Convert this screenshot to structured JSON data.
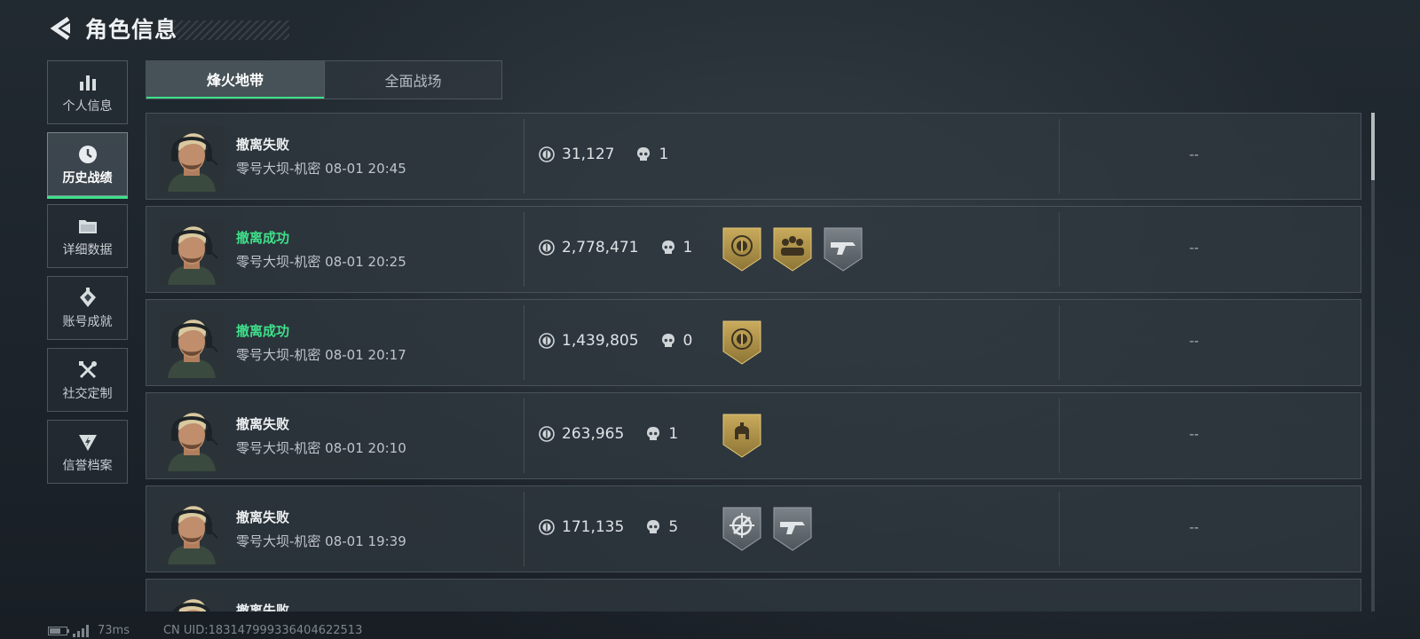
{
  "header": {
    "title": "角色信息",
    "back_icon": "back-arrow-icon"
  },
  "sidebar": {
    "items": [
      {
        "label": "个人信息",
        "icon": "bar-chart-icon",
        "active": false
      },
      {
        "label": "历史战绩",
        "icon": "clock-icon",
        "active": true
      },
      {
        "label": "详细数据",
        "icon": "folder-icon",
        "active": false
      },
      {
        "label": "账号成就",
        "icon": "achievement-icon",
        "active": false
      },
      {
        "label": "社交定制",
        "icon": "tools-icon",
        "active": false
      },
      {
        "label": "信誉档案",
        "icon": "shield-bolt-icon",
        "active": false
      }
    ]
  },
  "tabs": [
    {
      "label": "烽火地带",
      "active": true
    },
    {
      "label": "全面战场",
      "active": false
    }
  ],
  "records": [
    {
      "status": "撤离失败",
      "success": false,
      "map_time": "零号大坝-机密 08-01 20:45",
      "value": "31,127",
      "kills": "1",
      "badges": [],
      "extra": "--"
    },
    {
      "status": "撤离成功",
      "success": true,
      "map_time": "零号大坝-机密 08-01 20:25",
      "value": "2,778,471",
      "kills": "1",
      "badges": [
        "gold-coin-badge",
        "gold-team-badge",
        "grey-gun-badge"
      ],
      "extra": "--"
    },
    {
      "status": "撤离成功",
      "success": true,
      "map_time": "零号大坝-机密 08-01 20:17",
      "value": "1,439,805",
      "kills": "0",
      "badges": [
        "gold-coin-badge"
      ],
      "extra": "--"
    },
    {
      "status": "撤离失败",
      "success": false,
      "map_time": "零号大坝-机密 08-01 20:10",
      "value": "263,965",
      "kills": "1",
      "badges": [
        "gold-helmet-badge"
      ],
      "extra": "--"
    },
    {
      "status": "撤离失败",
      "success": false,
      "map_time": "零号大坝-机密 08-01 19:39",
      "value": "171,135",
      "kills": "5",
      "badges": [
        "grey-crosshair-badge",
        "grey-gun-badge"
      ],
      "extra": "--"
    },
    {
      "status": "撤离失败",
      "success": false,
      "map_time": "",
      "value": "",
      "kills": "",
      "badges": [],
      "extra": ""
    }
  ],
  "footer": {
    "ping": "73ms",
    "uid": "CN UID:183147999336404622513"
  },
  "colors": {
    "accent_green": "#3ee08a",
    "gold": "#b99a4e"
  }
}
